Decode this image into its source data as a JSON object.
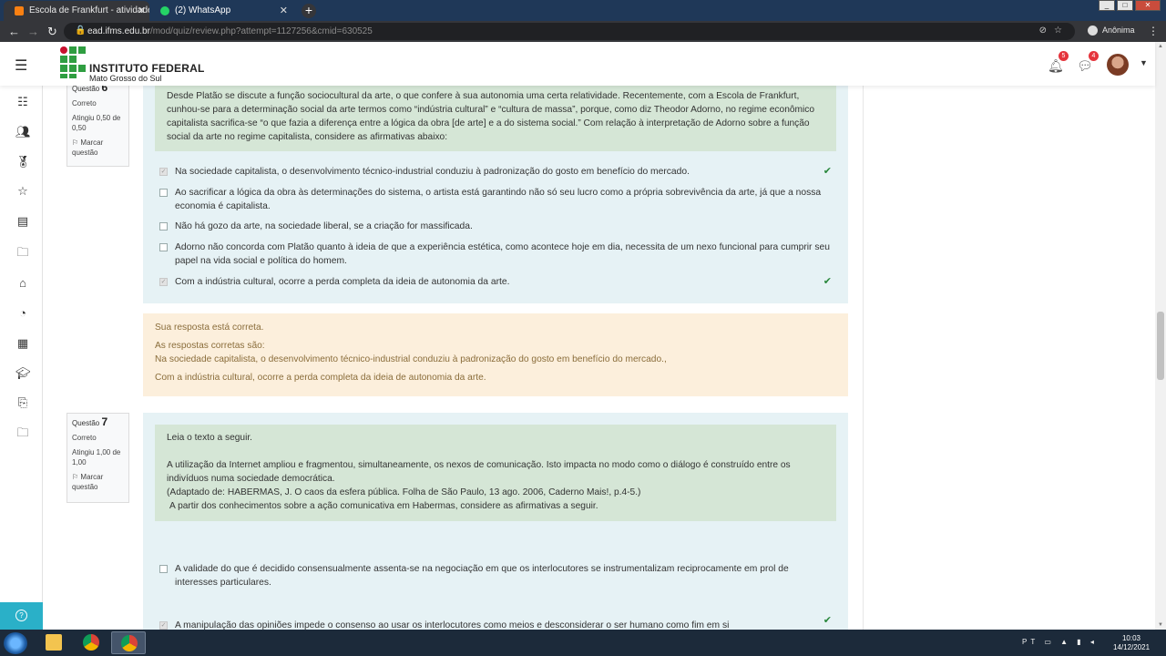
{
  "browser": {
    "tabs": [
      {
        "label": "Escola de Frankfurt - atividade d",
        "active": true
      },
      {
        "label": "(2) WhatsApp",
        "active": false
      }
    ],
    "url_domain": "ead.ifms.edu.br",
    "url_path": "/mod/quiz/review.php?attempt=1127256&cmid=630525",
    "profile_label": "Anônima"
  },
  "header": {
    "logo_title": "INSTITUTO FEDERAL",
    "logo_subtitle": "Mato Grosso do Sul",
    "notifications_count": "5",
    "messages_count": "4"
  },
  "q6": {
    "label": "Questão",
    "number": "6",
    "status": "Correto",
    "score": "Atingiu 0,50 de 0,50",
    "flag": "Marcar questão",
    "text": "Desde Platão se discute a função sociocultural da arte, o que confere à sua autonomia uma certa relatividade. Recentemente, com a Escola de Frankfurt, cunhou-se para a determinação social da arte termos como “indústria cultural” e “cultura de massa”, porque, como diz Theodor Adorno, no regime econômico capitalista sacrifica-se “o que fazia a diferença entre a lógica da obra [de arte] e a do sistema social.” Com relação à interpretação de Adorno sobre a função social da arte no regime capitalista, considere as afirmativas abaixo:",
    "options": [
      {
        "text": "Na sociedade capitalista, o desenvolvimento técnico-industrial conduziu à padronização do gosto em benefício do mercado.",
        "checked": true
      },
      {
        "text": "Ao sacrificar a lógica da obra às determinações do sistema, o artista está garantindo não só seu lucro como a própria sobrevivência da arte, já que a nossa economia é capitalista.",
        "checked": false
      },
      {
        "text": "Não há gozo da arte, na sociedade liberal, se a criação for massificada.",
        "checked": false
      },
      {
        "text": "Adorno não concorda com Platão quanto à ideia de que a experiência estética, como acontece hoje em dia, necessita de um nexo funcional para cumprir seu papel na vida social e política do homem.",
        "checked": false
      },
      {
        "text": "Com a indústria cultural, ocorre a perda completa da ideia de autonomia da arte.",
        "checked": true
      }
    ],
    "feedback": {
      "result": "Sua resposta está correta.",
      "intro": "As respostas corretas são:",
      "answer1": "Na sociedade capitalista, o desenvolvimento técnico-industrial conduziu à padronização do gosto em benefício do mercado.,",
      "answer2": "Com a indústria cultural, ocorre a perda completa da ideia de autonomia da arte."
    }
  },
  "q7": {
    "label": "Questão",
    "number": "7",
    "status": "Correto",
    "score": "Atingiu 1,00 de 1,00",
    "flag": "Marcar questão",
    "lead": "Leia o texto a seguir.",
    "quote": "A utilização da Internet ampliou e fragmentou, simultaneamente, os nexos de comunicação. Isto impacta no modo como o diálogo é construído entre os indivíduos numa sociedade democrática.",
    "source": "(Adaptado de: HABERMAS, J. O caos da esfera pública. Folha de São Paulo, 13 ago. 2006, Caderno Mais!, p.4-5.)",
    "prompt": "A partir dos conhecimentos sobre a ação comunicativa em Habermas, considere as afirmativas a seguir.",
    "options": [
      {
        "text": "A validade do que é decidido consensualmente assenta-se na negociação em que os interlocutores se instrumentalizam reciprocamente em prol de interesses particulares.",
        "checked": false
      },
      {
        "text": "A manipulação das opiniões impede o consenso ao usar os interlocutores como meios e desconsiderar o ser humano como fim em si",
        "checked": true
      }
    ]
  },
  "taskbar": {
    "lang": "PT",
    "time": "10:03",
    "date": "14/12/2021"
  },
  "colors": {
    "brand_green": "#2f9e41",
    "correct_green": "#28873b",
    "feedback_bg": "#fcefdc",
    "question_bg": "#e6f2f5",
    "qtext_bg": "#d5e6d6"
  }
}
